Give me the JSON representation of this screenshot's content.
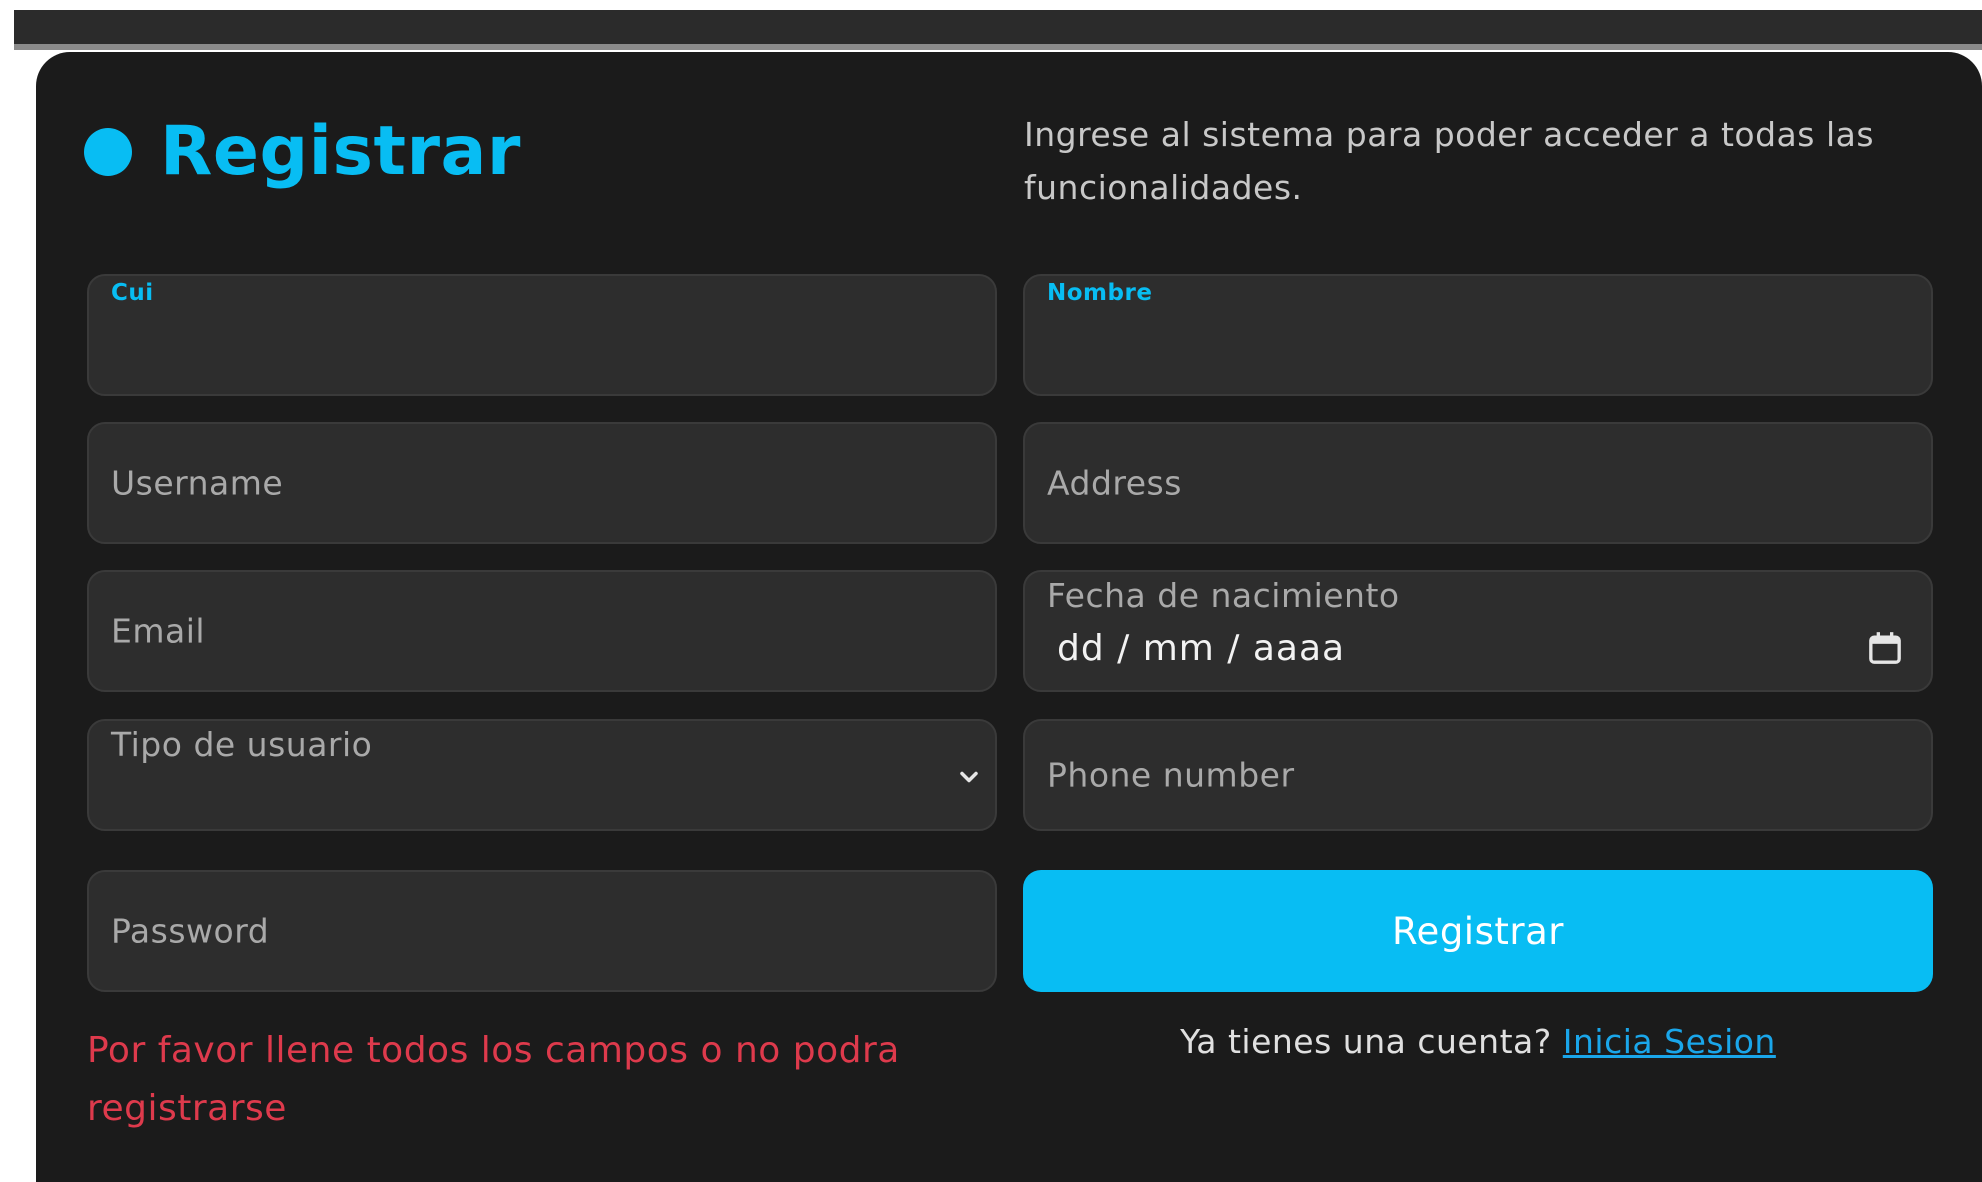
{
  "header": {
    "title": "Registrar",
    "subtitle": "Ingrese al sistema para poder acceder a todas las funcionalidades."
  },
  "form": {
    "cui": {
      "label": "Cui",
      "value": ""
    },
    "nombre": {
      "label": "Nombre",
      "value": ""
    },
    "username": {
      "placeholder": "Username"
    },
    "address": {
      "placeholder": "Address"
    },
    "email": {
      "placeholder": "Email"
    },
    "fecha": {
      "label": "Fecha de nacimiento",
      "value": "dd / mm / aaaa",
      "icon": "calendar-icon"
    },
    "tipo": {
      "label": "Tipo de usuario",
      "icon": "chevron-down-icon"
    },
    "phone": {
      "placeholder": "Phone number"
    },
    "password": {
      "placeholder": "Password"
    },
    "submit_label": "Registrar"
  },
  "error": "Por favor llene todos los campos o no podra registrarse",
  "login": {
    "prompt": "Ya tienes una cuenta?",
    "link": "Inicia Sesion"
  },
  "colors": {
    "accent": "#08bdf3",
    "error": "#de3a4c",
    "background": "#1b1b1b",
    "field": "#2d2d2d"
  }
}
